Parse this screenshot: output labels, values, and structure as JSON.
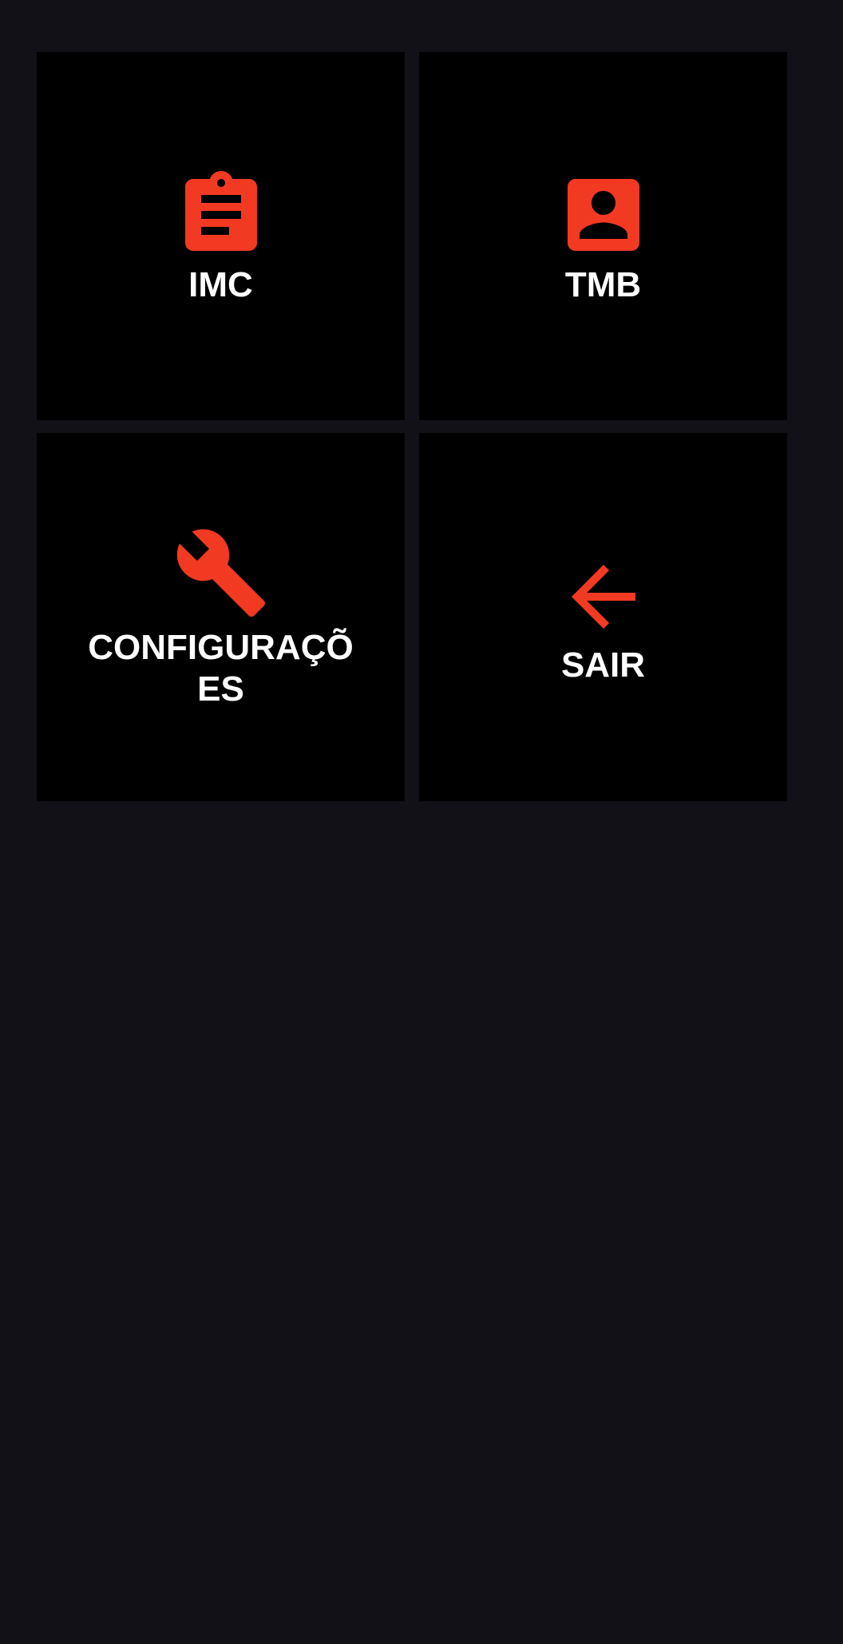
{
  "colors": {
    "background": "#131118",
    "tile_background": "#000000",
    "accent": "#F23A22",
    "label": "#FFFFFF"
  },
  "menu": {
    "items": [
      {
        "label": "IMC",
        "icon": "clipboard-icon"
      },
      {
        "label": "TMB",
        "icon": "person-card-icon"
      },
      {
        "label": "CONFIGURAÇÕES",
        "icon": "wrench-icon"
      },
      {
        "label": "SAIR",
        "icon": "arrow-left-icon"
      }
    ]
  }
}
